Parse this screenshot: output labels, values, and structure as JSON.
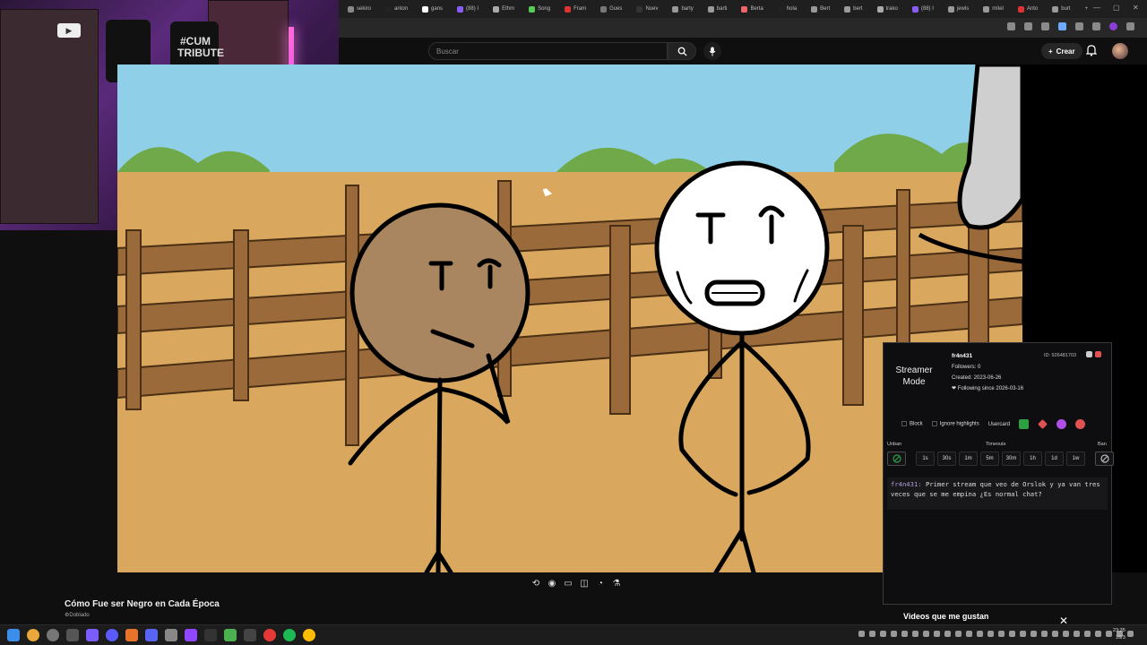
{
  "browser": {
    "tabs": [
      "sekiro",
      "anton",
      "gans",
      "(88) I",
      "Ethm",
      "Song",
      "Fram",
      "Gues",
      "Nuev",
      "barty",
      "barti",
      "Berta",
      "hola",
      "Bert",
      "bert",
      "trako",
      "(88) I",
      "jewls",
      "mitel",
      "Anto",
      "burt"
    ],
    "new_tab": "+"
  },
  "webcam": {
    "shirt_text": "#CUM TRIBUTE"
  },
  "youtube": {
    "search_placeholder": "Buscar",
    "create_label": "Crear",
    "video_title": "Cómo Fue ser Negro en Cada Época",
    "dubbed_label": "Doblado",
    "liked_videos_label": "Videos que me gustan",
    "close_label": "✕"
  },
  "usercard": {
    "streamer_mode": "Streamer Mode",
    "username": "fr4n431",
    "user_id": "ID: 926481703",
    "followers": "Followers: 0",
    "created": "Created: 2023-06-26",
    "following_since": "❤ Following since 2026-03-16",
    "block_label": "Block",
    "ignore_label": "Ignore highlights",
    "usercard_label": "Usercard",
    "unban_label": "Unban",
    "timeouts_label": "Timeouts",
    "ban_label": "Ban",
    "timeouts": [
      "1s",
      "30s",
      "1m",
      "5m",
      "30m",
      "1h",
      "1d",
      "1w"
    ],
    "message_nick": "fr4n431:",
    "message_text": " Primer stream que veo de Orslok y ya van tres veces que se me empina ¿Es normal chat?"
  },
  "taskbar": {
    "time": "23:35",
    "date": "16/3"
  },
  "colors": {
    "sky": "#8fd0e8",
    "ground": "#d9a85e",
    "fence": "#9a6a3a",
    "accent_green": "#2ea043",
    "accent_red": "#e05252",
    "accent_purple": "#b04ee8"
  }
}
